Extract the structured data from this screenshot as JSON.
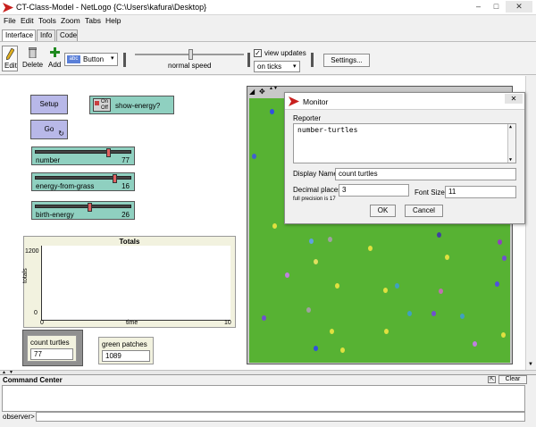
{
  "window": {
    "title": "CT-Class-Model - NetLogo {C:\\Users\\kafura\\Desktop}",
    "controls": {
      "minimize": "–",
      "maximize": "□",
      "close": "✕"
    }
  },
  "menu": [
    "File",
    "Edit",
    "Tools",
    "Zoom",
    "Tabs",
    "Help"
  ],
  "tabs": [
    {
      "label": "Interface",
      "active": true
    },
    {
      "label": "Info",
      "active": false
    },
    {
      "label": "Code",
      "active": false
    }
  ],
  "toolbar": {
    "edit_label": "Edit",
    "delete_label": "Delete",
    "add_label": "Add",
    "widget_type": "Button",
    "widget_type_prefix": "abc",
    "speed_label": "normal speed",
    "speed_level": 0.5,
    "view_updates_label": "view updates",
    "view_updates_checked": true,
    "update_mode": "on ticks",
    "settings_label": "Settings..."
  },
  "widgets": {
    "setup_label": "Setup",
    "go_label": "Go",
    "go_forever_icon": "↻",
    "switch": {
      "label": "show-energy?",
      "on": "On",
      "off": "Off"
    },
    "sliders": [
      {
        "name": "number",
        "value": "77",
        "fraction": 0.75
      },
      {
        "name": "energy-from-grass",
        "value": "16",
        "fraction": 0.82
      },
      {
        "name": "birth-energy",
        "value": "26",
        "fraction": 0.56
      }
    ],
    "plot": {
      "title": "Totals",
      "ylabel": "totals",
      "xlabel": "time",
      "y_max": "1200",
      "y_min": "0",
      "x_min": "0",
      "x_max": "10"
    },
    "monitors": [
      {
        "label": "count turtles",
        "value": "77"
      },
      {
        "label": "green patches",
        "value": "1089"
      }
    ]
  },
  "view": {
    "patch_color": "#57b233",
    "controls": [
      "◢",
      "✥",
      "▲▼"
    ]
  },
  "dialog": {
    "title": "Monitor",
    "reporter_label": "Reporter",
    "reporter_value": "number-turtles",
    "display_name_label": "Display Name",
    "display_name_value": "count turtles",
    "decimal_label": "Decimal places",
    "decimal_value": "3",
    "precision_note": "full precision is 17",
    "font_size_label": "Font Size",
    "font_size_value": "11",
    "ok_label": "OK",
    "cancel_label": "Cancel",
    "close_icon": "✕"
  },
  "command_center": {
    "title": "Command Center",
    "clear_label": "Clear",
    "prompt": "observer>"
  }
}
